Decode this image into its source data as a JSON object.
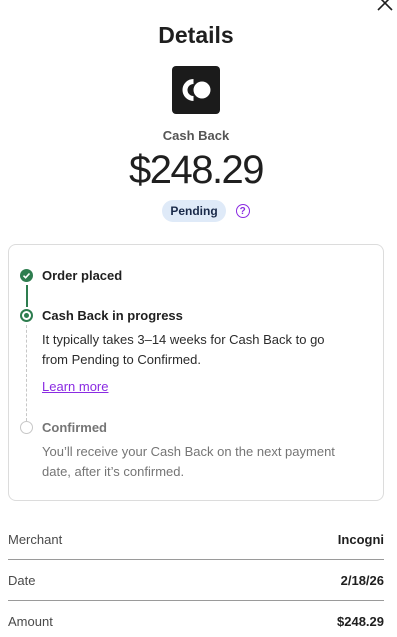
{
  "header": {
    "title": "Details",
    "close_icon": "close-icon"
  },
  "merchant_logo": {
    "icon": "merchant-logo",
    "colors": {
      "background": "#1b1b1b",
      "mark": "#ffffff"
    }
  },
  "summary": {
    "label": "Cash Back",
    "amount": "$248.29",
    "status": "Pending",
    "help_icon": "question-circle-icon",
    "help_glyph": "?"
  },
  "timeline": {
    "steps": [
      {
        "title": "Order placed",
        "state": "done"
      },
      {
        "title": "Cash Back in progress",
        "state": "active",
        "description_lines": [
          "It typically takes 3–14 weeks for Cash Back to go",
          "from Pending to Confirmed."
        ],
        "link": "Learn more"
      },
      {
        "title": "Confirmed",
        "state": "pending",
        "description_lines": [
          "You’ll receive your Cash Back on the next payment",
          "date, after it’s confirmed."
        ]
      }
    ]
  },
  "details": [
    {
      "label": "Merchant",
      "value": "Incogni"
    },
    {
      "label": "Date",
      "value": "2/18/26"
    },
    {
      "label": "Amount",
      "value": "$248.29"
    }
  ],
  "colors": {
    "accent_green": "#2e7d4f",
    "link_purple": "#8a2be2",
    "badge_bg": "#dfeaf8"
  }
}
